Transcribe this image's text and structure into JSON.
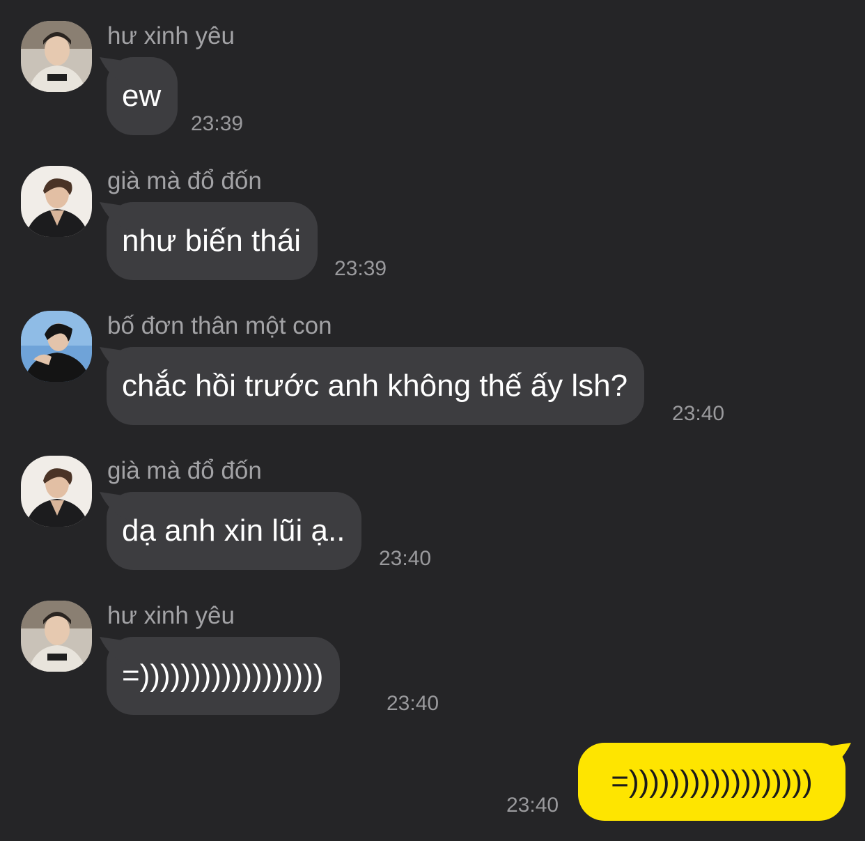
{
  "messages": [
    {
      "sender": "hư xinh yêu",
      "text": "ew",
      "time": "23:39",
      "avatar": "avatar-light-hoodie"
    },
    {
      "sender": "già mà đổ đốn",
      "text": "như biến thái",
      "time": "23:39",
      "avatar": "avatar-dark-jacket"
    },
    {
      "sender": "bố đơn thân một con",
      "text": "chắc hồi trước anh không thế ấy lsh?",
      "time": "23:40",
      "avatar": "avatar-blue-background"
    },
    {
      "sender": "già mà đổ đốn",
      "text": "dạ anh xin lũi ạ..",
      "time": "23:40",
      "avatar": "avatar-dark-jacket"
    },
    {
      "sender": "hư xinh yêu",
      "text": "=))))))))))))))))))",
      "time": "23:40",
      "avatar": "avatar-light-hoodie"
    }
  ],
  "own_message": {
    "text": "=))))))))))))))))))",
    "time": "23:40"
  },
  "colors": {
    "background": "#252527",
    "incoming_bubble": "#3d3d40",
    "outgoing_bubble": "#fee500",
    "sender_text": "#a3a3a6",
    "timestamp_text": "#9a9a9d"
  }
}
